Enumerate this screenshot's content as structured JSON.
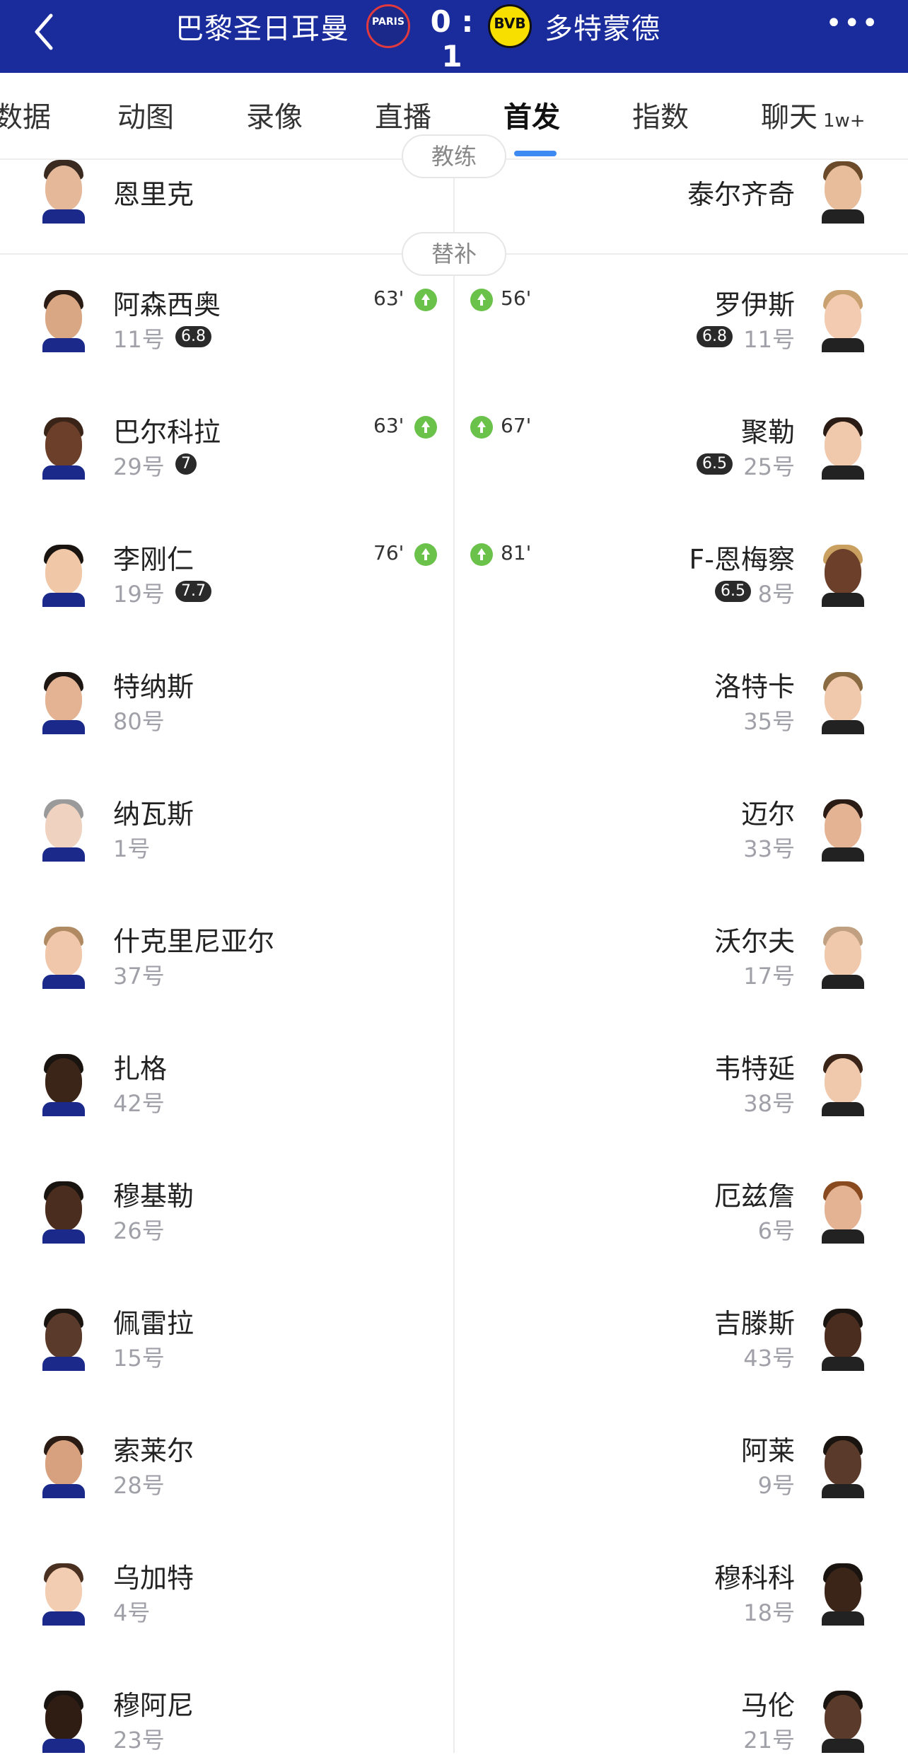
{
  "match": {
    "home_team": "巴黎圣日耳曼",
    "away_team": "多特蒙德",
    "score": "0 : 1",
    "home_crest_text": "PARIS",
    "away_crest_text": "BVB",
    "more_label": "•••"
  },
  "tabs": [
    {
      "label": "数据"
    },
    {
      "label": "动图"
    },
    {
      "label": "录像"
    },
    {
      "label": "直播"
    },
    {
      "label": "首发",
      "active": true
    },
    {
      "label": "指数"
    },
    {
      "label": "聊天",
      "badge": "1w+"
    }
  ],
  "sections": {
    "coach_label": "教练",
    "subs_label": "替补"
  },
  "coaches": {
    "home": "恩里克",
    "away": "泰尔齐奇"
  },
  "subs": {
    "home": [
      {
        "name": "阿森西奥",
        "number": "11号",
        "rating": "6.8",
        "sub_minute": "63'"
      },
      {
        "name": "巴尔科拉",
        "number": "29号",
        "rating": "7",
        "sub_minute": "63'"
      },
      {
        "name": "李刚仁",
        "number": "19号",
        "rating": "7.7",
        "sub_minute": "76'"
      },
      {
        "name": "特纳斯",
        "number": "80号"
      },
      {
        "name": "纳瓦斯",
        "number": "1号"
      },
      {
        "name": "什克里尼亚尔",
        "number": "37号"
      },
      {
        "name": "扎格",
        "number": "42号"
      },
      {
        "name": "穆基勒",
        "number": "26号"
      },
      {
        "name": "佩雷拉",
        "number": "15号"
      },
      {
        "name": "索莱尔",
        "number": "28号"
      },
      {
        "name": "乌加特",
        "number": "4号"
      },
      {
        "name": "穆阿尼",
        "number": "23号"
      }
    ],
    "away": [
      {
        "name": "罗伊斯",
        "number": "11号",
        "rating": "6.8",
        "sub_minute": "56'"
      },
      {
        "name": "聚勒",
        "number": "25号",
        "rating": "6.5",
        "sub_minute": "67'"
      },
      {
        "name": "F-恩梅察",
        "number": "8号",
        "rating": "6.5",
        "sub_minute": "81'"
      },
      {
        "name": "洛特卡",
        "number": "35号"
      },
      {
        "name": "迈尔",
        "number": "33号"
      },
      {
        "name": "沃尔夫",
        "number": "17号"
      },
      {
        "name": "韦特延",
        "number": "38号"
      },
      {
        "name": "厄兹詹",
        "number": "6号"
      },
      {
        "name": "吉滕斯",
        "number": "43号"
      },
      {
        "name": "阿莱",
        "number": "9号"
      },
      {
        "name": "穆科科",
        "number": "18号"
      },
      {
        "name": "马伦",
        "number": "21号"
      }
    ]
  },
  "colors": {
    "header_bg": "#1a2b9c",
    "tab_indicator": "#3d8bf2",
    "sub_icon": "#6ac24a",
    "rating_bg": "#2a2a2a"
  }
}
